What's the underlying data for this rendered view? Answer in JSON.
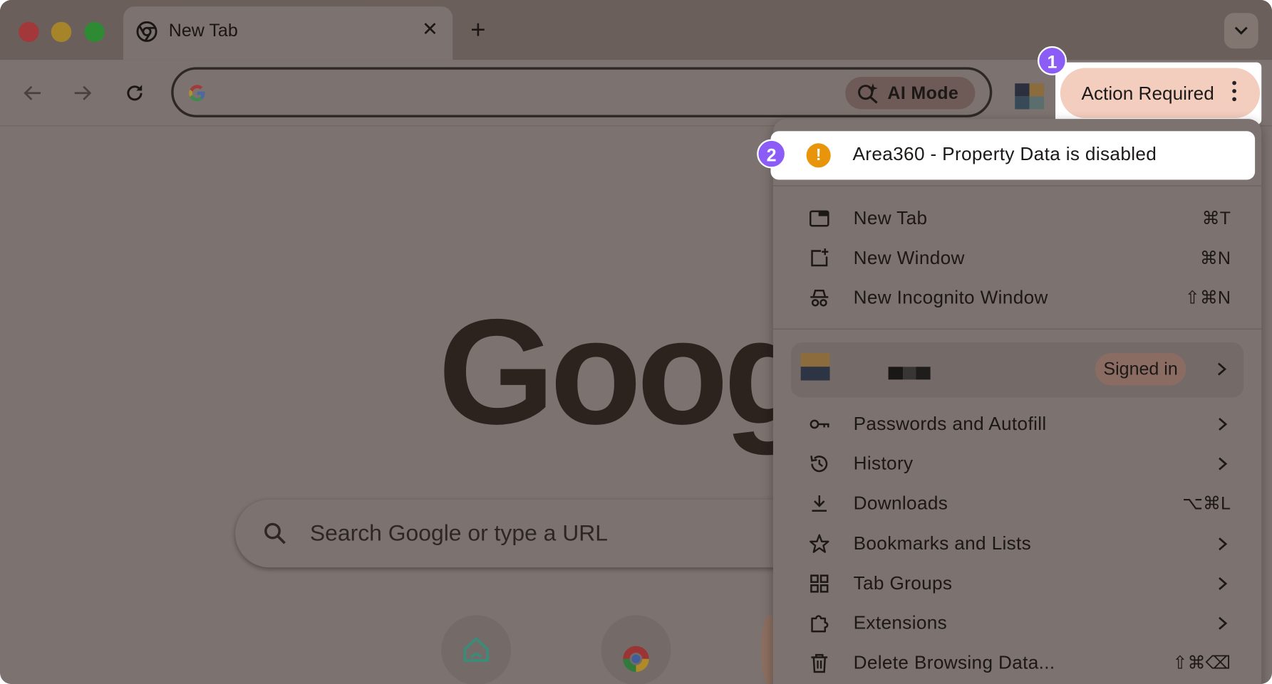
{
  "tab": {
    "title": "New Tab",
    "close_glyph": "✕",
    "new_tab_glyph": "+"
  },
  "omnibox": {
    "ai_mode_label": "AI Mode"
  },
  "action_button": {
    "label": "Action Required"
  },
  "badges": {
    "first": "1",
    "second": "2"
  },
  "page": {
    "logo_text": "Google",
    "search_placeholder": "Search Google or type a URL"
  },
  "menu": {
    "alert": {
      "icon": "!",
      "label": "Area360 - Property Data is disabled"
    },
    "items_top": [
      {
        "label": "New Tab",
        "shortcut": "⌘T",
        "icon": "new-tab-icon"
      },
      {
        "label": "New Window",
        "shortcut": "⌘N",
        "icon": "new-window-icon"
      },
      {
        "label": "New Incognito Window",
        "shortcut": "⇧⌘N",
        "icon": "incognito-icon"
      }
    ],
    "profile": {
      "status": "Signed in"
    },
    "items_bottom": [
      {
        "label": "Passwords and Autofill",
        "shortcut": "",
        "icon": "key-icon",
        "submenu": true
      },
      {
        "label": "History",
        "shortcut": "",
        "icon": "history-icon",
        "submenu": true
      },
      {
        "label": "Downloads",
        "shortcut": "⌥⌘L",
        "icon": "download-icon",
        "submenu": false
      },
      {
        "label": "Bookmarks and Lists",
        "shortcut": "",
        "icon": "star-icon",
        "submenu": true
      },
      {
        "label": "Tab Groups",
        "shortcut": "",
        "icon": "tab-groups-icon",
        "submenu": true
      },
      {
        "label": "Extensions",
        "shortcut": "",
        "icon": "extensions-icon",
        "submenu": true
      },
      {
        "label": "Delete Browsing Data...",
        "shortcut": "⇧⌘⌫",
        "icon": "trash-icon",
        "submenu": false
      }
    ]
  },
  "colors": {
    "badge": "#8b5cf6",
    "action_button": "#f3cdbe",
    "alert": "#e8950c"
  }
}
